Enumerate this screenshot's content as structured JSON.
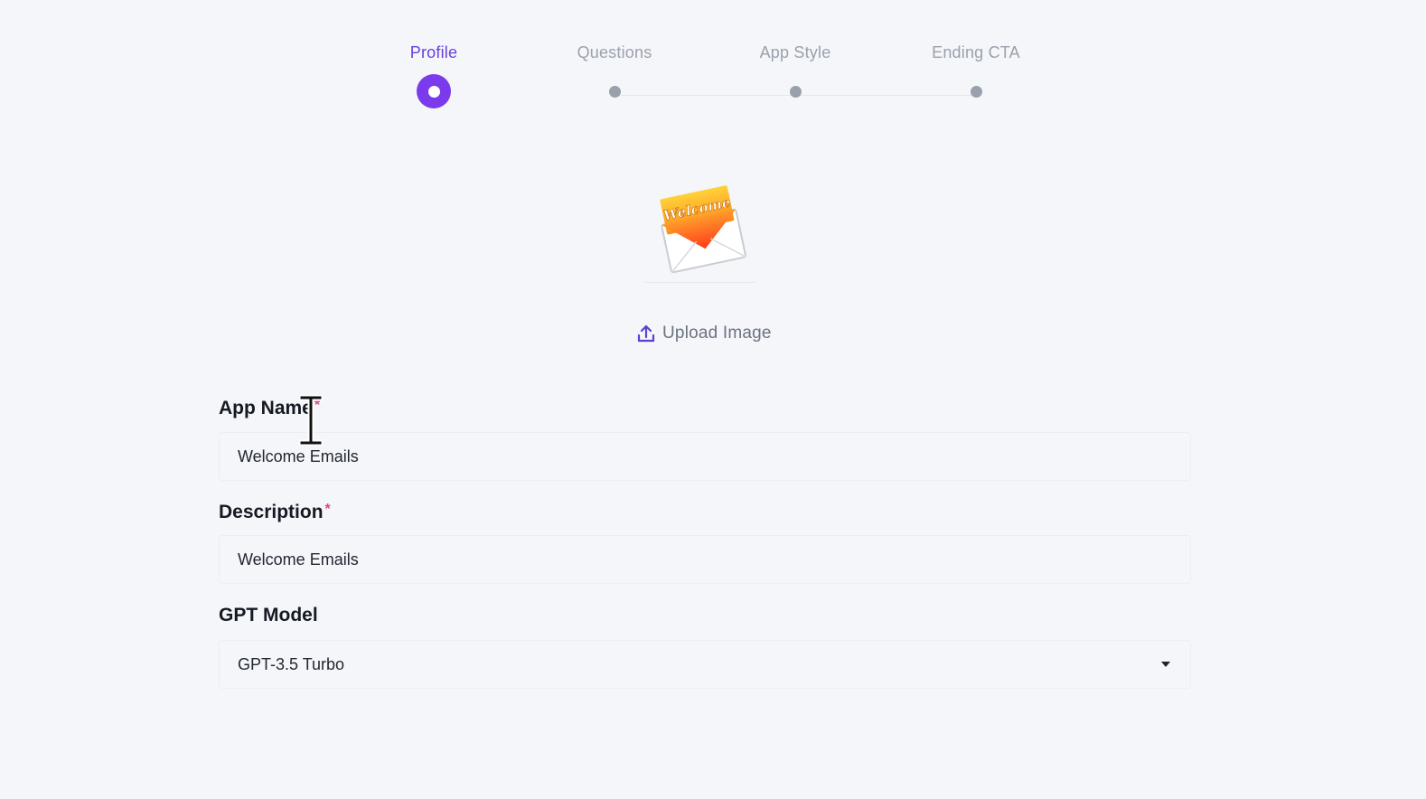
{
  "stepper": {
    "steps": [
      {
        "label": "Profile",
        "active": true
      },
      {
        "label": "Questions",
        "active": false
      },
      {
        "label": "App Style",
        "active": false
      },
      {
        "label": "Ending CTA",
        "active": false
      }
    ]
  },
  "image": {
    "envelope_text": "Welcome",
    "upload_label": "Upload Image"
  },
  "form": {
    "app_name": {
      "label": "App Name",
      "required_mark": "*",
      "value": "Welcome Emails"
    },
    "description": {
      "label": "Description",
      "required_mark": "*",
      "value": "Welcome Emails"
    },
    "gpt_model": {
      "label": "GPT Model",
      "value": "GPT-3.5 Turbo"
    }
  },
  "colors": {
    "accent": "#7c3aed",
    "active_label": "#6a3fe0",
    "inactive": "#9aa1ad",
    "required": "#e0457b",
    "background": "#f4f6f9"
  }
}
